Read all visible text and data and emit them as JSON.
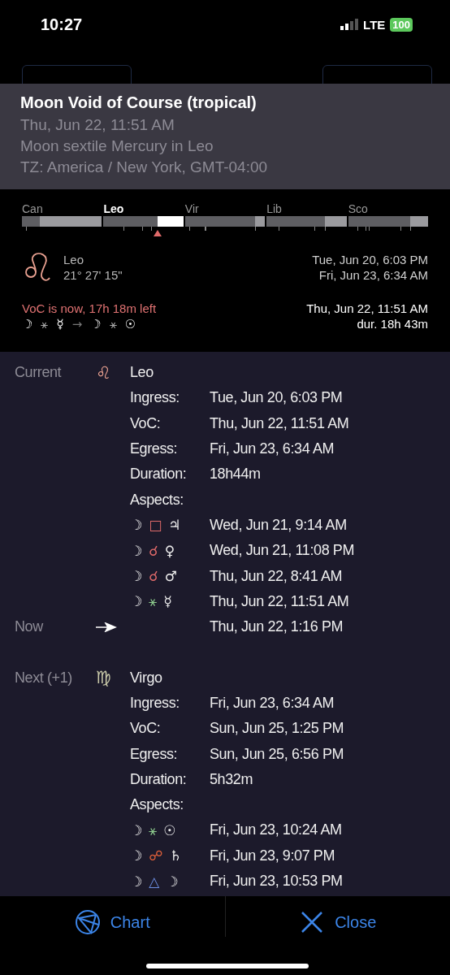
{
  "status_bar": {
    "time": "10:27",
    "network": "LTE",
    "battery": "100"
  },
  "header": {
    "title": "Moon Void of Course (tropical)",
    "lines": [
      "Thu, Jun 22, 11:51 AM",
      "Moon sextile Mercury in Leo",
      "TZ: America / New York, GMT-04:00"
    ]
  },
  "timeline": [
    {
      "label": "Can",
      "selected": false,
      "level": 0.78
    },
    {
      "label": "Leo",
      "selected": true,
      "level": 0.32
    },
    {
      "label": "Vir",
      "selected": false,
      "level": 0.12
    },
    {
      "label": "Lib",
      "selected": false,
      "level": 0.27
    },
    {
      "label": "Sco",
      "selected": false,
      "level": 0.22
    }
  ],
  "summary": {
    "sign": "Leo",
    "degree": "21° 27' 15\"",
    "ingress": "Tue, Jun 20, 6:03 PM",
    "egress": "Fri, Jun 23, 6:34 AM",
    "voc_status": "VoC is now, 17h 18m left",
    "voc_sequence": [
      {
        "glyph": "☽",
        "kind": "planet"
      },
      {
        "glyph": "⚹",
        "kind": "aspect"
      },
      {
        "glyph": "☿",
        "kind": "planet"
      },
      {
        "glyph": "→",
        "kind": "arrow"
      },
      {
        "glyph": "☽",
        "kind": "planet"
      },
      {
        "glyph": "⚹",
        "kind": "aspect"
      },
      {
        "glyph": "☉",
        "kind": "planet"
      }
    ],
    "voc_time": "Thu, Jun 22, 11:51 AM",
    "duration": "dur. 18h 43m"
  },
  "periods": [
    {
      "label": "Current",
      "glyph": "♌",
      "color": "#e8a090",
      "sign": "Leo",
      "fields": [
        {
          "key": "Ingress:",
          "value": "Tue, Jun 20, 6:03 PM"
        },
        {
          "key": "VoC:",
          "value": "Thu, Jun 22, 11:51 AM"
        },
        {
          "key": "Egress:",
          "value": "Fri, Jun 23, 6:34 AM"
        },
        {
          "key": "Duration:",
          "value": "18h44m"
        }
      ],
      "aspects_label": "Aspects:",
      "aspects": [
        {
          "planet1": "☽",
          "aspect": "□",
          "kind": "square",
          "planet2": "♃",
          "time": "Wed, Jun 21, 9:14 AM"
        },
        {
          "planet1": "☽",
          "aspect": "☌",
          "kind": "conjunction",
          "planet2": "♀",
          "time": "Wed, Jun 21, 11:08 PM"
        },
        {
          "planet1": "☽",
          "aspect": "☌",
          "kind": "conjunction",
          "planet2": "♂",
          "time": "Thu, Jun 22, 8:41 AM"
        },
        {
          "planet1": "☽",
          "aspect": "⚹",
          "kind": "sextile",
          "planet2": "☿",
          "time": "Thu, Jun 22, 11:51 AM"
        }
      ]
    },
    {
      "label": "Now",
      "kind": "now",
      "time": "Thu, Jun 22, 1:16 PM"
    },
    {
      "label": "Next (+1)",
      "glyph": "♍",
      "color": "#c8c8a8",
      "sign": "Virgo",
      "fields": [
        {
          "key": "Ingress:",
          "value": "Fri, Jun 23, 6:34 AM"
        },
        {
          "key": "VoC:",
          "value": "Sun, Jun 25, 1:25 PM"
        },
        {
          "key": "Egress:",
          "value": "Sun, Jun 25, 6:56 PM"
        },
        {
          "key": "Duration:",
          "value": "5h32m"
        }
      ],
      "aspects_label": "Aspects:",
      "aspects": [
        {
          "planet1": "☽",
          "aspect": "⚹",
          "kind": "sextile",
          "planet2": "☉",
          "time": "Fri, Jun 23, 10:24 AM"
        },
        {
          "planet1": "☽",
          "aspect": "☍",
          "kind": "opposition",
          "planet2": "♄",
          "time": "Fri, Jun 23, 9:07 PM"
        },
        {
          "planet1": "☽",
          "aspect": "△",
          "kind": "trine",
          "planet2": "☽",
          "time": "Fri, Jun 23, 10:53 PM"
        }
      ]
    }
  ],
  "actions": [
    {
      "label": "Chart",
      "kind": "chart"
    },
    {
      "label": "Close",
      "kind": "close"
    }
  ]
}
